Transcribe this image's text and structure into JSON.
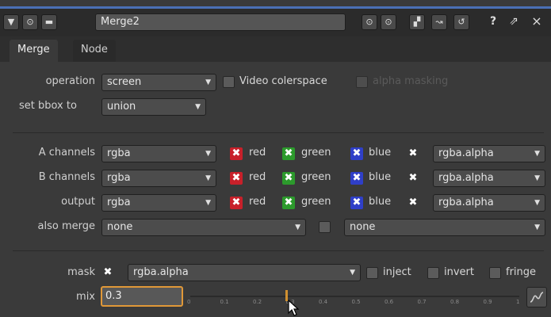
{
  "titlebar": {
    "node_name": "Merge2",
    "left_buttons": [
      "▼",
      "⊙",
      "▬"
    ],
    "right_buttons": [
      "⊙",
      "⊙",
      "▞",
      "↝",
      "↺"
    ],
    "help_label": "?",
    "float_label": "⇗",
    "close_label": "×"
  },
  "tabs": [
    {
      "label": "Merge"
    },
    {
      "label": "Node"
    }
  ],
  "operation": {
    "label": "operation",
    "value": "screen",
    "video_colorspace_label": "Video colerspace",
    "alpha_masking_label": "alpha masking"
  },
  "bbox": {
    "label": "set bbox to",
    "value": "union"
  },
  "channels": {
    "red_label": "red",
    "green_label": "green",
    "blue_label": "blue",
    "rows": [
      {
        "label": "A channels",
        "value": "rgba",
        "alpha": "rgba.alpha"
      },
      {
        "label": "B channels",
        "value": "rgba",
        "alpha": "rgba.alpha"
      },
      {
        "label": "output",
        "value": "rgba",
        "alpha": "rgba.alpha"
      }
    ]
  },
  "also_merge": {
    "label": "also merge",
    "value": "none",
    "value2": "none"
  },
  "mask": {
    "label": "mask",
    "value": "rgba.alpha",
    "inject_label": "inject",
    "invert_label": "invert",
    "fringe_label": "fringe"
  },
  "mix": {
    "label": "mix",
    "value": "0.3",
    "ticks": [
      "0",
      "0.1",
      "0.2",
      "0.3",
      "0.4",
      "0.5",
      "0.6",
      "0.7",
      "0.8",
      "0.9",
      "1"
    ]
  }
}
